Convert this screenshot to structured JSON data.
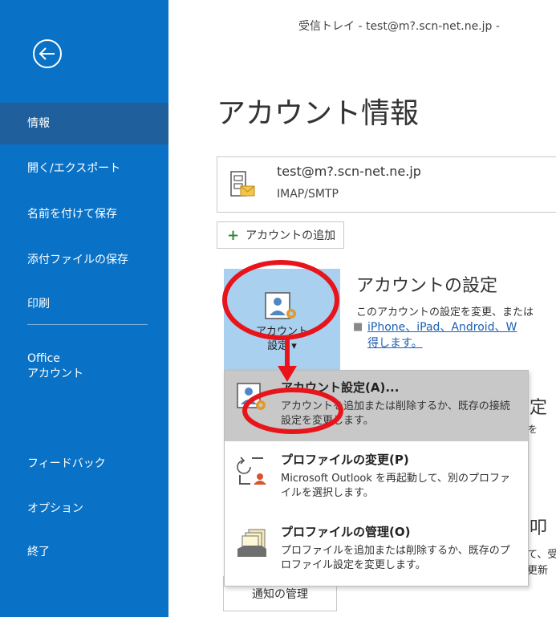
{
  "window": {
    "title": "受信トレイ - test@m?.scn-net.ne.jp -"
  },
  "sidebar": {
    "back_label": "",
    "items": [
      {
        "label": "情報"
      },
      {
        "label": "開く/エクスポート"
      },
      {
        "label": "名前を付けて保存"
      },
      {
        "label": "添付ファイルの保存"
      },
      {
        "label": "印刷"
      },
      {
        "label_line1": "Office",
        "label_line2": "アカウント"
      },
      {
        "label": "フィードバック"
      },
      {
        "label": "オプション"
      },
      {
        "label": "終了"
      }
    ]
  },
  "main": {
    "page_title": "アカウント情報",
    "account": {
      "email": "test@m?.scn-net.ne.jp",
      "type": "IMAP/SMTP"
    },
    "add_account_label": "アカウントの追加",
    "settings_tile": {
      "line1": "アカウント",
      "line2": "設定 ▾"
    },
    "section": {
      "title": "アカウントの設定",
      "description": "このアカウントの設定を変更、または",
      "link_line1": "iPhone、iPad、Android、W",
      "link_line2": "得します。"
    },
    "background_fragments": {
      "a": "定",
      "b": "を",
      "c": "叩",
      "d1": "て、受",
      "d2": "更新"
    },
    "notify_button_label": "通知の管理"
  },
  "dropdown": {
    "items": [
      {
        "title": "アカウント設定(A)...",
        "desc": "アカウントを追加または削除するか、既存の接続設定を変更します。",
        "icon": "account-settings-icon"
      },
      {
        "title": "プロファイルの変更(P)",
        "desc": "Microsoft Outlook を再起動して、別のプロファイルを選択します。",
        "icon": "profile-change-icon"
      },
      {
        "title": "プロファイルの管理(O)",
        "desc": "プロファイルを追加または削除するか、既存のプロファイル設定を変更します。",
        "icon": "profile-manage-icon"
      }
    ]
  },
  "colors": {
    "sidebar": "#0a72c6",
    "sidebar_active": "#1f5f9c",
    "annotation": "#e8141b",
    "tile": "#a9d0ee"
  }
}
